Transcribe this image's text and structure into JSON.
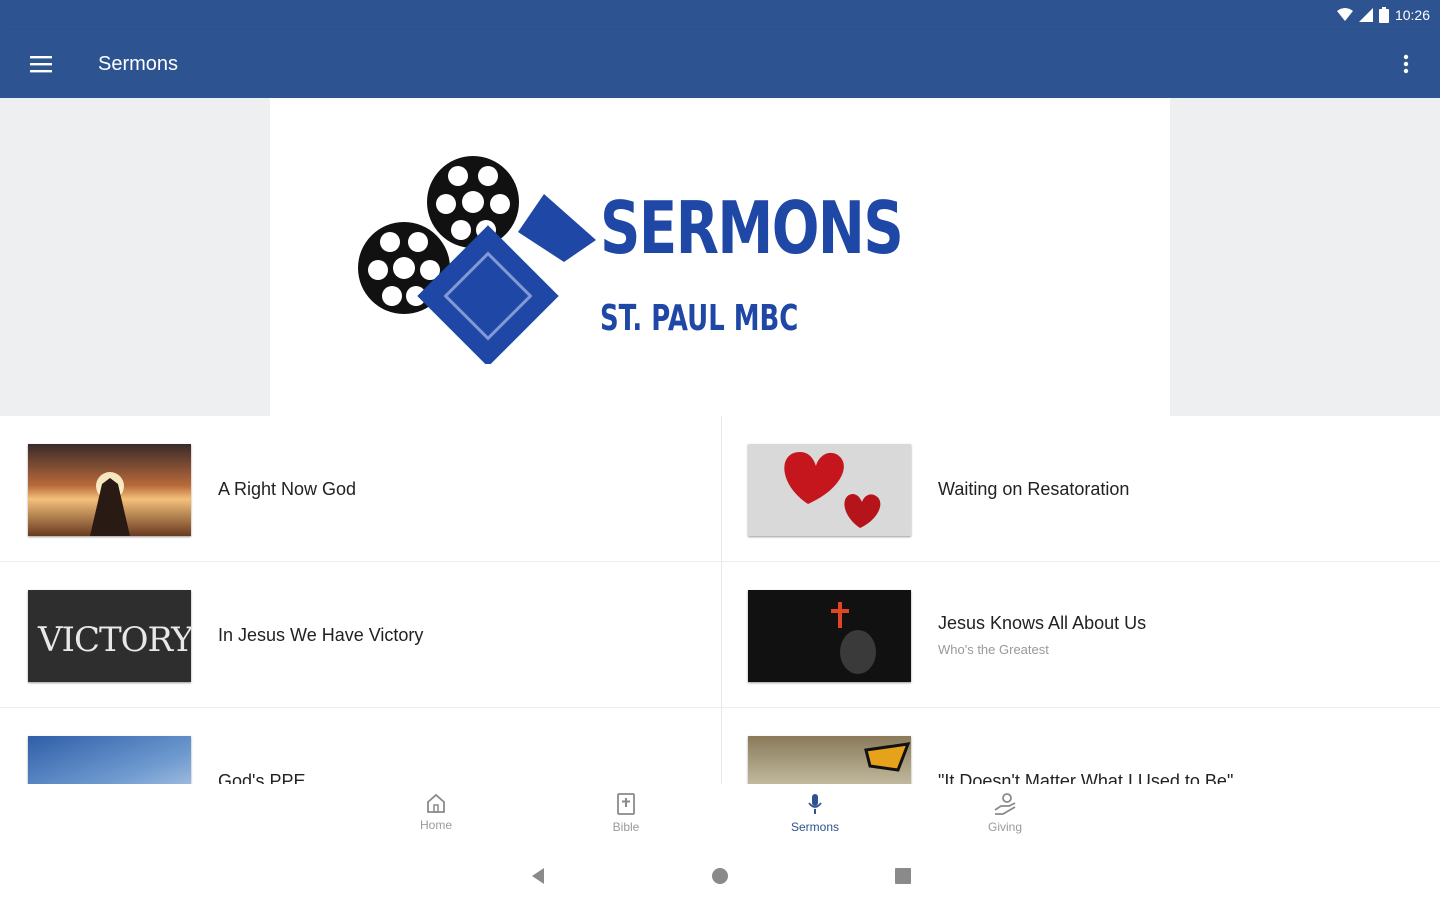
{
  "status_bar": {
    "time": "10:26",
    "icons": [
      "wifi-icon",
      "signal-icon",
      "battery-icon"
    ]
  },
  "app_bar": {
    "title": "Sermons",
    "menu_icon": "menu-icon",
    "overflow_icon": "more-vert-icon"
  },
  "banner": {
    "title": "SERMONS",
    "subtitle": "ST. PAUL MBC",
    "logo_icon": "film-camera-icon"
  },
  "sermons_left": [
    {
      "title": "A Right Now God",
      "subtitle": "",
      "thumb": "praying-hands-sunset"
    },
    {
      "title": "In Jesus We Have Victory",
      "subtitle": "",
      "thumb": "victory-chalkboard",
      "thumb_text": "VICTORY"
    },
    {
      "title": "God's PPE",
      "subtitle": "",
      "thumb": "ppe-mask"
    }
  ],
  "sermons_right": [
    {
      "title": "Waiting on Resatoration",
      "subtitle": "",
      "thumb": "red-hearts"
    },
    {
      "title": "Jesus Knows All About Us",
      "subtitle": "Who's the Greatest",
      "thumb": "dark-cross"
    },
    {
      "title": "\"It Doesn't Matter What I Used to Be\"",
      "subtitle": "",
      "thumb": "butterfly"
    }
  ],
  "bottom_nav": [
    {
      "label": "Home",
      "icon": "home-icon",
      "active": false
    },
    {
      "label": "Bible",
      "icon": "bible-icon",
      "active": false
    },
    {
      "label": "Sermons",
      "icon": "microphone-icon",
      "active": true
    },
    {
      "label": "Giving",
      "icon": "giving-hand-icon",
      "active": false
    }
  ],
  "colors": {
    "primary": "#2d5391",
    "brand_blue": "#1f47a6",
    "banner_bg": "#eeeff1"
  }
}
